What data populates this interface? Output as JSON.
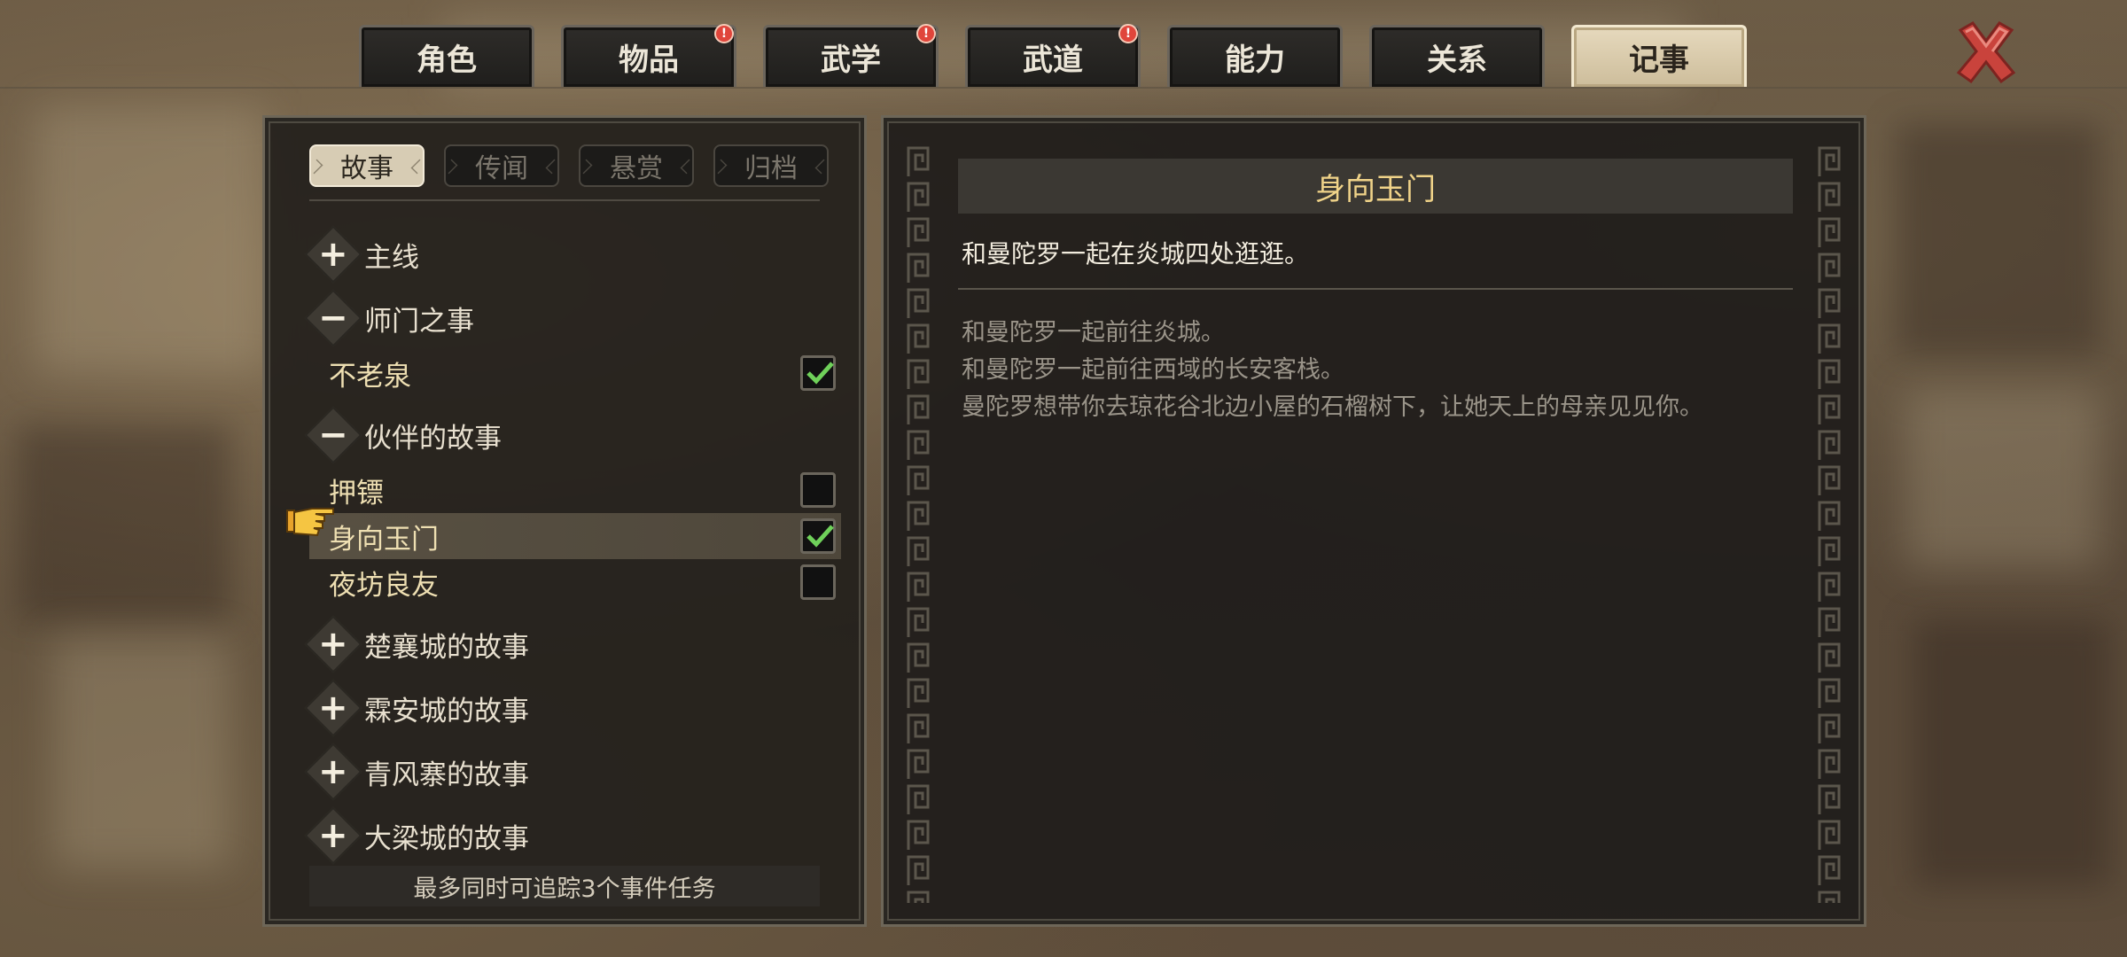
{
  "tabs": [
    {
      "label": "角色",
      "badge": false
    },
    {
      "label": "物品",
      "badge": true
    },
    {
      "label": "武学",
      "badge": true
    },
    {
      "label": "武道",
      "badge": true
    },
    {
      "label": "能力",
      "badge": false
    },
    {
      "label": "关系",
      "badge": false
    },
    {
      "label": "记事",
      "badge": false,
      "active": true
    }
  ],
  "badge_glyph": "!",
  "subtabs": [
    {
      "label": "故事",
      "active": true
    },
    {
      "label": "传闻"
    },
    {
      "label": "悬赏"
    },
    {
      "label": "归档"
    }
  ],
  "quest_list": [
    {
      "category": "主线",
      "expanded": false,
      "quests": []
    },
    {
      "category": "师门之事",
      "expanded": true,
      "quests": [
        {
          "name": "不老泉",
          "tracked": true
        }
      ]
    },
    {
      "category": "伙伴的故事",
      "expanded": true,
      "quests": [
        {
          "name": "押镖",
          "tracked": false
        },
        {
          "name": "身向玉门",
          "tracked": true,
          "selected": true
        },
        {
          "name": "夜坊良友",
          "tracked": false
        }
      ]
    },
    {
      "category": "楚襄城的故事",
      "expanded": false,
      "quests": []
    },
    {
      "category": "霖安城的故事",
      "expanded": false,
      "quests": []
    },
    {
      "category": "青风寨的故事",
      "expanded": false,
      "quests": []
    },
    {
      "category": "大梁城的故事",
      "expanded": false,
      "quests": []
    }
  ],
  "footer_note": "最多同时可追踪3个事件任务",
  "detail": {
    "title": "身向玉门",
    "current_step": "和曼陀罗一起在炎城四处逛逛。",
    "history": [
      "和曼陀罗一起前往炎城。",
      "和曼陀罗一起前往西域的长安客栈。",
      "曼陀罗想带你去琼花谷北边小屋的石榴树下，让她天上的母亲见见你。"
    ]
  },
  "icons": {
    "close": "close-x-icon",
    "expand": "plus-icon",
    "collapse": "minus-icon",
    "pointer": "pointing-hand-icon",
    "check": "checkmark-icon"
  },
  "colors": {
    "title_gold": "#f0d389",
    "check_green": "#6fd15a",
    "badge_red": "#e0453b",
    "close_red": "#c9433c"
  }
}
